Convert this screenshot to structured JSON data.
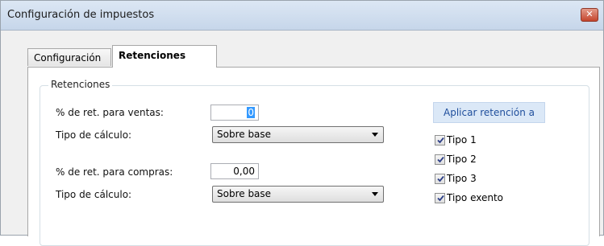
{
  "window": {
    "title": "Configuración de impuestos",
    "close_glyph": "✕"
  },
  "tabs": [
    {
      "label": "Configuración",
      "active": false
    },
    {
      "label": "Retenciones",
      "active": true
    }
  ],
  "group": {
    "legend": "Retenciones"
  },
  "sales": {
    "label": "% de ret. para ventas:",
    "value": "0",
    "calc_label": "Tipo de cálculo:",
    "calc_value": "Sobre base"
  },
  "purchases": {
    "label": "% de ret. para compras:",
    "value": "0,00",
    "calc_label": "Tipo de cálculo:",
    "calc_value": "Sobre base"
  },
  "apply": {
    "title": "Aplicar retención a",
    "items": [
      {
        "label": "Tipo 1",
        "checked": true
      },
      {
        "label": "Tipo 2",
        "checked": true
      },
      {
        "label": "Tipo 3",
        "checked": true
      },
      {
        "label": "Tipo exento",
        "checked": true
      }
    ]
  }
}
